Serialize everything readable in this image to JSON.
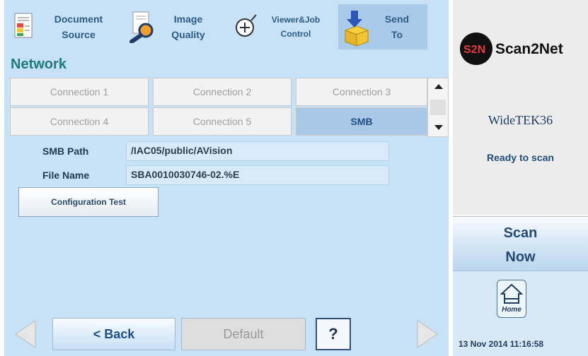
{
  "toolbar": {
    "buttons": [
      {
        "line1": "Document",
        "line2": "Source",
        "icon": "document-icon"
      },
      {
        "line1": "Image",
        "line2": "Quality",
        "icon": "magnifier-icon"
      },
      {
        "line1": "Viewer&Job",
        "line2": "Control",
        "icon": "zoom-out-icon"
      },
      {
        "line1": "Send",
        "line2": "To",
        "icon": "send-box-icon"
      }
    ],
    "active_index": 3
  },
  "section_title": "Network",
  "tabs": [
    {
      "label": "Connection 1",
      "active": false
    },
    {
      "label": "Connection 2",
      "active": false
    },
    {
      "label": "Connection 3",
      "active": false
    },
    {
      "label": "Connection 4",
      "active": false
    },
    {
      "label": "Connection 5",
      "active": false
    },
    {
      "label": "SMB",
      "active": true
    }
  ],
  "form": {
    "smb_path_label": "SMB Path",
    "smb_path_value": "/IAC05/public/AVision",
    "file_name_label": "File Name",
    "file_name_value": "SBA0010030746-02.%E",
    "config_test_label": "Configuration Test"
  },
  "bottom": {
    "back_label": "< Back",
    "default_label": "Default",
    "help_label": "?"
  },
  "right_panel": {
    "brand_mark": "S2N",
    "brand_name": "Scan2Net",
    "device": "WideTEK36",
    "status": "Ready to scan",
    "scan_line1": "Scan",
    "scan_line2": "Now",
    "home_label": "Home",
    "timestamp": "13 Nov 2014 11:16:58"
  },
  "colors": {
    "panel_bg": "#c7e1f7",
    "active_tab": "#a9c8e5",
    "title_teal": "#1f7a78",
    "text_blue": "#1e4f86"
  }
}
